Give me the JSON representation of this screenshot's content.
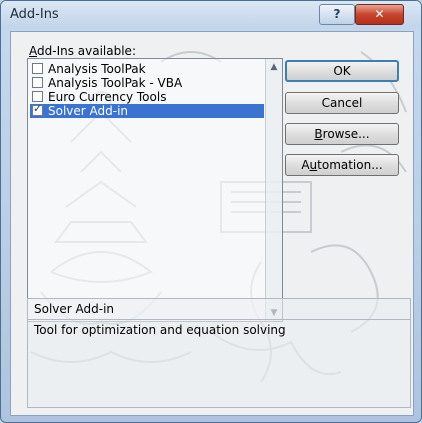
{
  "window": {
    "title": "Add-Ins",
    "help_glyph": "?",
    "close_glyph": "✕"
  },
  "addins": {
    "label_prefix": "",
    "label_accel": "A",
    "label_rest": "dd-Ins available:",
    "items": [
      {
        "label": "Analysis ToolPak",
        "checked": false,
        "selected": false
      },
      {
        "label": "Analysis ToolPak - VBA",
        "checked": false,
        "selected": false
      },
      {
        "label": "Euro Currency Tools",
        "checked": false,
        "selected": false
      },
      {
        "label": "Solver Add-in",
        "checked": true,
        "selected": true
      }
    ]
  },
  "buttons": {
    "ok": "OK",
    "cancel": "Cancel",
    "browse_accel": "B",
    "browse_rest": "rowse...",
    "automation_prefix": "A",
    "automation_accel": "u",
    "automation_rest": "tomation..."
  },
  "description": {
    "title": "Solver Add-in",
    "text": "Tool for optimization and equation solving"
  }
}
